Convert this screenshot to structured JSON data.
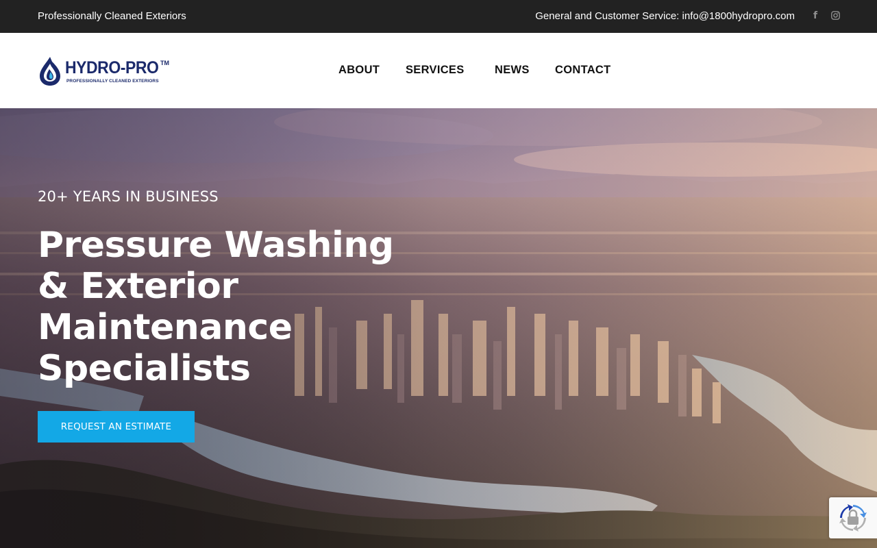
{
  "topbar": {
    "tagline": "Professionally Cleaned Exteriors",
    "service": "General and Customer Service: info@1800hydropro.com",
    "social": [
      {
        "icon": "facebook-icon",
        "glyph": "f"
      },
      {
        "icon": "instagram-icon"
      }
    ]
  },
  "header": {
    "logo": {
      "name": "HYDRO-PRO",
      "tm": "TM",
      "sub": "PROFESSIONALLY CLEANED EXTERIORS"
    },
    "nav": {
      "about": "ABOUT",
      "services": "SERVICES",
      "news": "NEWS",
      "contact": "CONTACT"
    }
  },
  "hero": {
    "eyebrow": "20+ YEARS IN BUSINESS",
    "headline_lines": [
      "Pressure Washing",
      "& Exterior",
      "Maintenance",
      "Specialists"
    ],
    "cta": "REQUEST AN ESTIMATE"
  },
  "colors": {
    "topbar_bg": "#222222",
    "brand_navy": "#1b2a6b",
    "cta_blue": "#13a8e6"
  }
}
